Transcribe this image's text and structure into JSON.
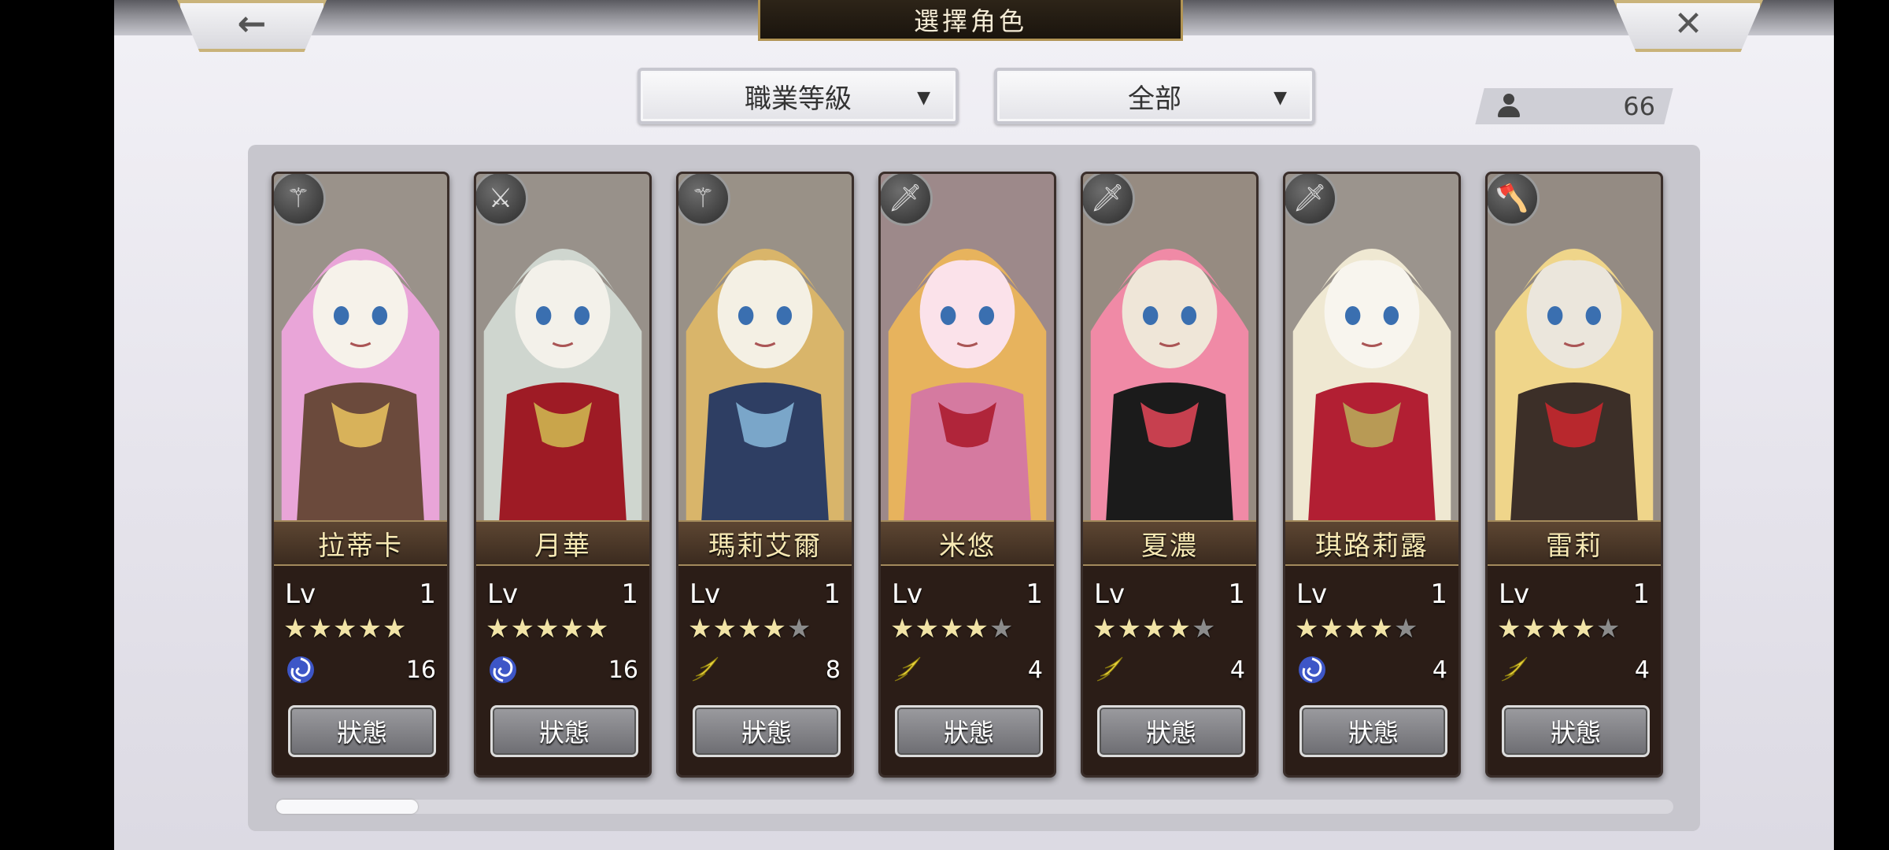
{
  "header": {
    "title": "選擇角色",
    "back_icon": "arrow-left-icon",
    "close_icon": "close-icon",
    "back_glyph": "←",
    "close_glyph": "✕"
  },
  "filters": {
    "sort_value": "職業等級",
    "category_value": "全部"
  },
  "roster_count": "66",
  "status_label": "狀態",
  "scroll": {
    "position_fraction": 0.0
  },
  "colors": {
    "star_on": "#f1e3a6",
    "star_off": "#8b8b8b",
    "name_text": "#f7e9b4"
  },
  "characters": [
    {
      "name": "拉蒂卡",
      "lv_label": "Lv",
      "level": "1",
      "stars": 5,
      "element": "water-swirl-icon",
      "value": "16",
      "weapon": "staff-icon",
      "palette": [
        "#e9a5d8",
        "#6b4a3c",
        "#f6f2ea",
        "#d8b25a"
      ]
    },
    {
      "name": "月華",
      "lv_label": "Lv",
      "level": "1",
      "stars": 5,
      "element": "water-swirl-icon",
      "value": "16",
      "weapon": "blade-icon",
      "palette": [
        "#cfd6cf",
        "#9e1b25",
        "#f3f1ea",
        "#c9a54b"
      ]
    },
    {
      "name": "瑪莉艾爾",
      "lv_label": "Lv",
      "level": "1",
      "stars": 4,
      "element": "wind-wing-icon",
      "value": "8",
      "weapon": "staff-icon",
      "palette": [
        "#d9b56a",
        "#2e3e63",
        "#f4f0e4",
        "#7aa6c9"
      ]
    },
    {
      "name": "米悠",
      "lv_label": "Lv",
      "level": "1",
      "stars": 4,
      "element": "wind-wing-icon",
      "value": "4",
      "weapon": "sword-icon",
      "palette": [
        "#e7b35d",
        "#d57aa0",
        "#fbe2ea",
        "#b0253a"
      ]
    },
    {
      "name": "夏濃",
      "lv_label": "Lv",
      "level": "1",
      "stars": 4,
      "element": "wind-wing-icon",
      "value": "4",
      "weapon": "sword-icon",
      "palette": [
        "#f08aa6",
        "#1b1b1b",
        "#efe6d8",
        "#c7404f"
      ]
    },
    {
      "name": "琪路莉露",
      "lv_label": "Lv",
      "level": "1",
      "stars": 4,
      "element": "water-swirl-icon",
      "value": "4",
      "weapon": "sword-icon",
      "palette": [
        "#efe8d2",
        "#b21f33",
        "#f8f5ee",
        "#b89a55"
      ]
    },
    {
      "name": "雷莉",
      "lv_label": "Lv",
      "level": "1",
      "stars": 4,
      "element": "wind-wing-icon",
      "value": "4",
      "weapon": "axe-icon",
      "palette": [
        "#efd58a",
        "#3c2f28",
        "#ebe6dc",
        "#b8282d"
      ]
    }
  ]
}
